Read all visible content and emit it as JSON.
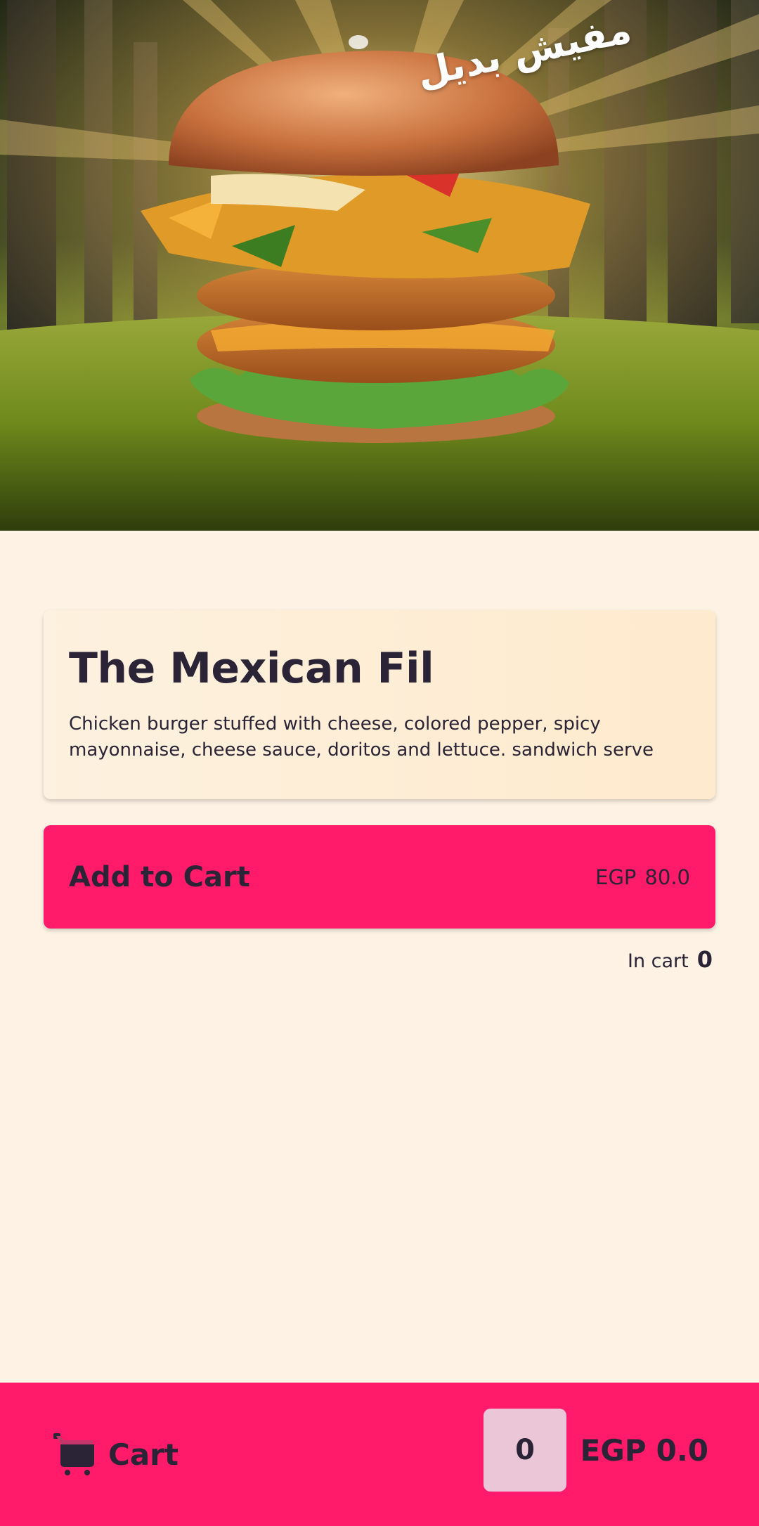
{
  "hero": {
    "caption": "مفيش بديل"
  },
  "product": {
    "title": "The Mexican Fil",
    "description": "Chicken burger stuffed with cheese, colored pepper, spicy mayonnaise, cheese sauce, doritos and lettuce. sandwich serve"
  },
  "add_to_cart": {
    "label": "Add to Cart",
    "currency": "EGP",
    "price": "80.0"
  },
  "in_cart": {
    "label": "In cart",
    "count": "0"
  },
  "bottom_bar": {
    "cart_label": "Cart",
    "cart_icon": "cart-icon",
    "item_count": "0",
    "currency": "EGP",
    "total": "0.0"
  },
  "colors": {
    "accent": "#ff1a6a",
    "background": "#fdf2e4",
    "text": "#2a2436",
    "count_box": "#ebc6d6"
  }
}
